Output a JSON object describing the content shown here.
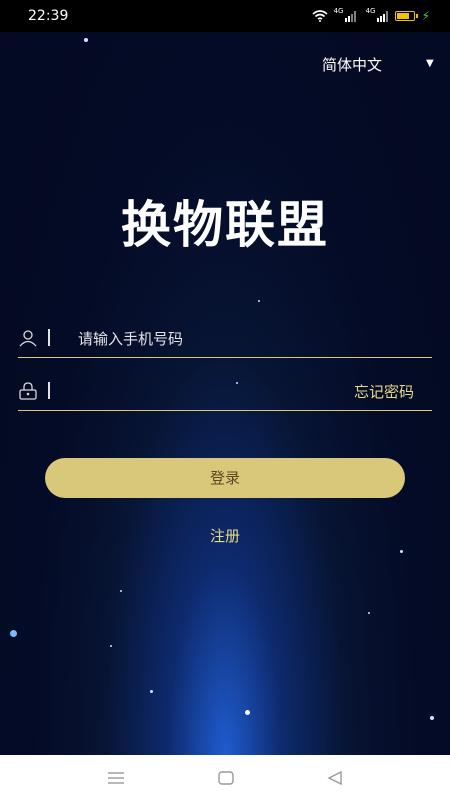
{
  "status": {
    "time": "22:39",
    "net1": "4G",
    "net2": "4G",
    "battery_level": 0.75
  },
  "language": {
    "label": "简体中文",
    "caret": "▼"
  },
  "app": {
    "title": "换物联盟"
  },
  "phone": {
    "placeholder": "请输入手机号码",
    "icon": "user-icon"
  },
  "password": {
    "forgot_label": "忘记密码",
    "icon": "lock-icon"
  },
  "login": {
    "label": "登录"
  },
  "register": {
    "label": "注册"
  },
  "nav": {
    "menu_icon": "menu-icon",
    "home_icon": "home-icon",
    "back_icon": "back-icon"
  },
  "colors": {
    "accent": "#dac87a",
    "background": "#040b26",
    "text_gold": "#e8d98a"
  }
}
